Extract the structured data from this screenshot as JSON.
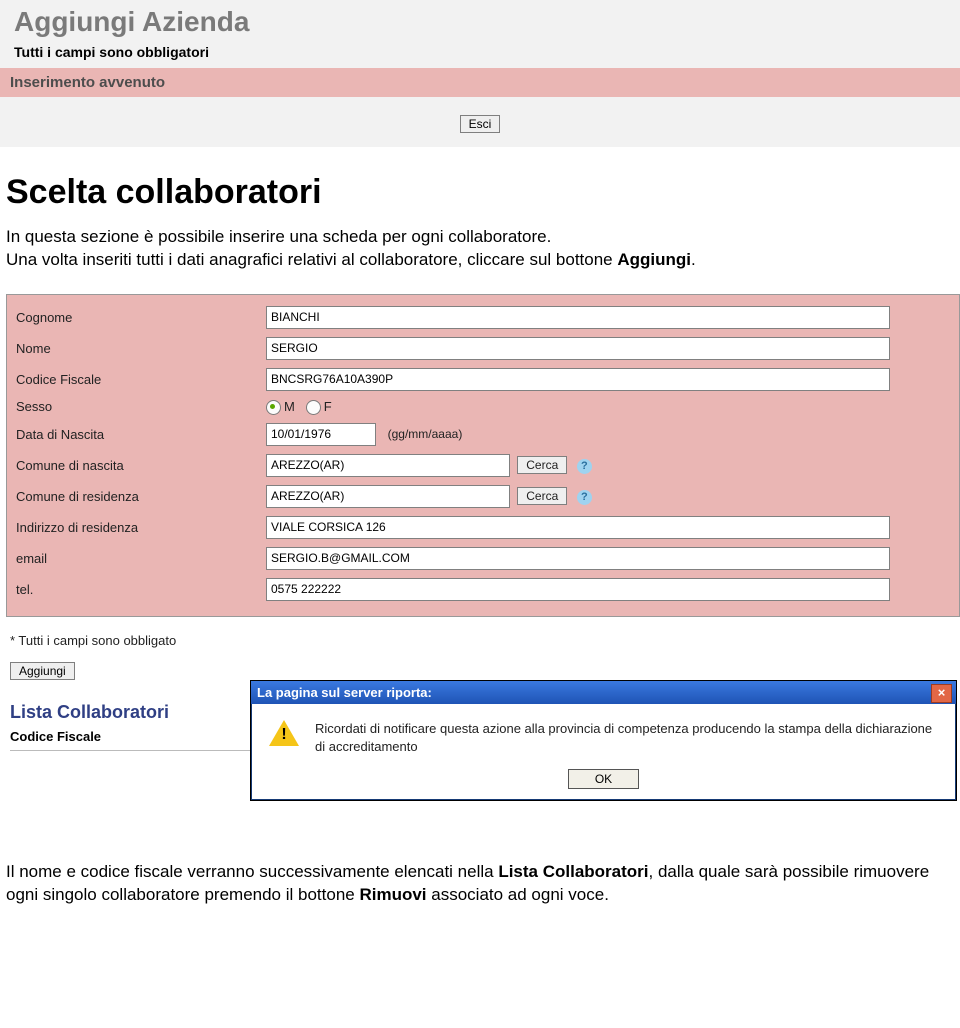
{
  "top": {
    "title": "Aggiungi Azienda",
    "subtitle": "Tutti i campi sono obbligatori",
    "banner": "Inserimento avvenuto",
    "esci": "Esci"
  },
  "section_heading": "Scelta collaboratori",
  "intro_text_1": "In questa sezione è possibile inserire una scheda per ogni collaboratore.",
  "intro_text_2a": "Una volta inseriti tutti i dati anagrafici relativi al collaboratore, cliccare sul bottone ",
  "intro_text_2b": "Aggiungi",
  "intro_text_2c": ".",
  "form": {
    "labels": {
      "cognome": "Cognome",
      "nome": "Nome",
      "codice_fiscale": "Codice Fiscale",
      "sesso": "Sesso",
      "data_nascita": "Data di Nascita",
      "comune_nascita": "Comune di nascita",
      "comune_residenza": "Comune di residenza",
      "indirizzo_residenza": "Indirizzo di residenza",
      "email": "email",
      "tel": "tel."
    },
    "values": {
      "cognome": "BIANCHI",
      "nome": "SERGIO",
      "codice_fiscale": "BNCSRG76A10A390P",
      "sesso_m": "M",
      "sesso_f": "F",
      "sesso_selected": "M",
      "data_nascita": "10/01/1976",
      "data_hint": "(gg/mm/aaaa)",
      "comune_nascita": "AREZZO(AR)",
      "comune_residenza": "AREZZO(AR)",
      "cerca": "Cerca",
      "indirizzo_residenza": "VIALE CORSICA 126",
      "email": "SERGIO.B@GMAIL.COM",
      "tel": "0575 222222"
    },
    "footer_note_prefix": "* Tutti i campi sono obbligato",
    "aggiungi": "Aggiungi"
  },
  "lista": {
    "title": "Lista Collaboratori",
    "col_header": "Codice Fiscale"
  },
  "dialog": {
    "title": "La pagina sul server riporta:",
    "body": "Ricordati di notificare questa azione alla provincia di competenza  producendo la stampa della dichiarazione di accreditamento",
    "ok": "OK"
  },
  "para2_a": "Il nome e codice fiscale verranno successivamente elencati nella ",
  "para2_b": "Lista Collaboratori",
  "para2_c": ", dalla quale sarà possibile rimuovere ogni singolo collaboratore premendo il bottone ",
  "para2_d": "Rimuovi",
  "para2_e": " associato ad ogni voce."
}
